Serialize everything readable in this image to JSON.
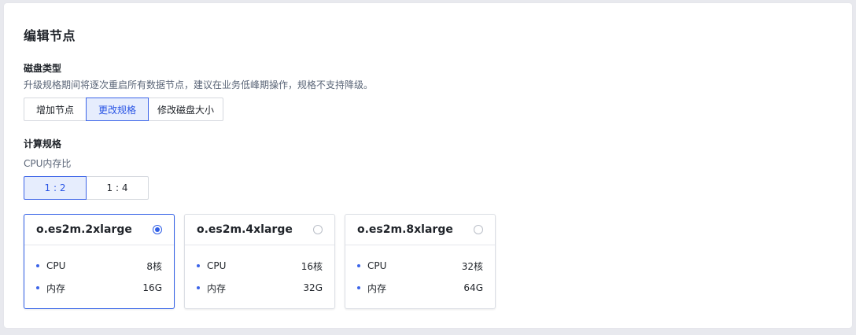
{
  "dialog": {
    "title": "编辑节点"
  },
  "disk_type": {
    "label": "磁盘类型",
    "hint": "升级规格期间将逐次重启所有数据节点，建议在业务低峰期操作，规格不支持降级。",
    "tabs": [
      {
        "label": "增加节点",
        "active": false
      },
      {
        "label": "更改规格",
        "active": true
      },
      {
        "label": "修改磁盘大小",
        "active": false
      }
    ]
  },
  "compute_spec": {
    "label": "计算规格",
    "ratio_label": "CPU内存比",
    "ratios": [
      {
        "label": "1 : 2",
        "active": true
      },
      {
        "label": "1 : 4",
        "active": false
      }
    ],
    "cards": [
      {
        "name": "o.es2m.2xlarge",
        "selected": true,
        "cpu_label": "CPU",
        "cpu_value": "8核",
        "mem_label": "内存",
        "mem_value": "16G"
      },
      {
        "name": "o.es2m.4xlarge",
        "selected": false,
        "cpu_label": "CPU",
        "cpu_value": "16核",
        "mem_label": "内存",
        "mem_value": "32G"
      },
      {
        "name": "o.es2m.8xlarge",
        "selected": false,
        "cpu_label": "CPU",
        "cpu_value": "32核",
        "mem_label": "内存",
        "mem_value": "64G"
      }
    ]
  },
  "colors": {
    "accent": "#2f5ee6",
    "active_bg": "#e6edfd",
    "border": "#d5d8de"
  }
}
